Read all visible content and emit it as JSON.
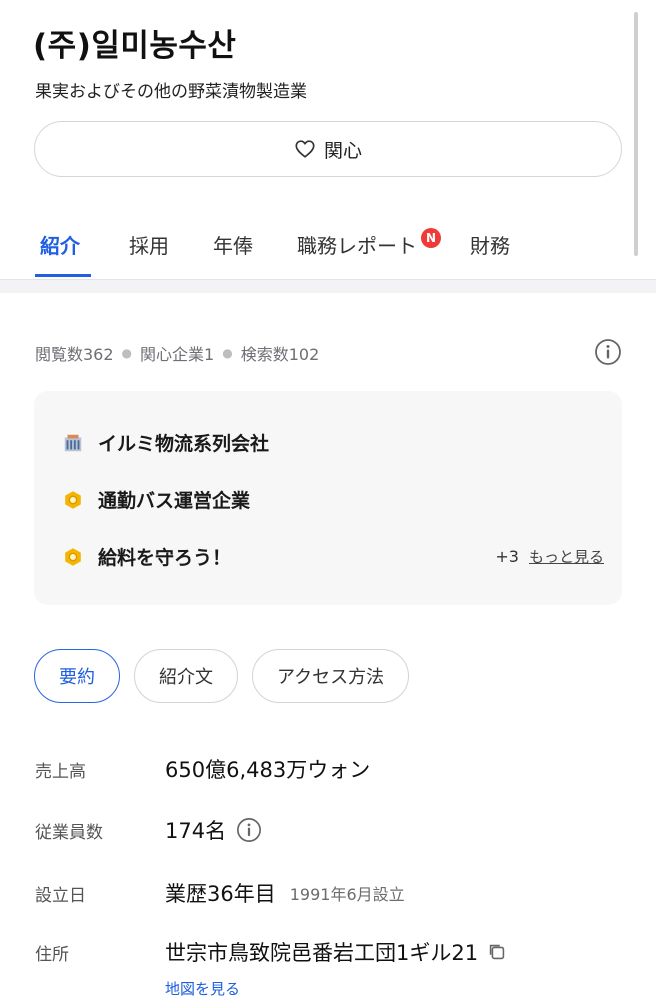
{
  "company": {
    "name": "(주)일미농수산",
    "industry": "果実およびその他の野菜漬物製造業",
    "follow_label": "関心"
  },
  "tabs": [
    {
      "label": "紹介",
      "active": true
    },
    {
      "label": "採用",
      "active": false
    },
    {
      "label": "年俸",
      "active": false
    },
    {
      "label": "職務レポート",
      "active": false,
      "badge": "N"
    },
    {
      "label": "財務",
      "active": false
    }
  ],
  "stats": {
    "views": "閲覧数362",
    "interested": "関心企業1",
    "searches": "検索数102"
  },
  "highlights": {
    "items": [
      {
        "text": "イルミ物流系列会社",
        "icon": "building-icon"
      },
      {
        "text": "通勤バス運営企業",
        "icon": "hexagon-badge-icon"
      },
      {
        "text": "給料を守ろう！",
        "icon": "hexagon-badge-icon"
      }
    ],
    "more_count": "+3",
    "more_label": "もっと見る"
  },
  "chips": [
    {
      "label": "要約",
      "active": true
    },
    {
      "label": "紹介文",
      "active": false
    },
    {
      "label": "アクセス方法",
      "active": false
    }
  ],
  "summary": {
    "revenue_label": "売上高",
    "revenue_value": "650億6,483万ウォン",
    "employees_label": "従業員数",
    "employees_value": "174名",
    "founded_label": "設立日",
    "founded_value": "業歴36年目",
    "founded_sub": "1991年6月設立",
    "address_label": "住所",
    "address_value": "世宗市鳥致院邑番岩工団1ギル21",
    "map_link": "地図を見る"
  },
  "colors": {
    "accent": "#1f5fe0",
    "badge": "#f03a3a",
    "hex_badge": "#f5b400"
  }
}
